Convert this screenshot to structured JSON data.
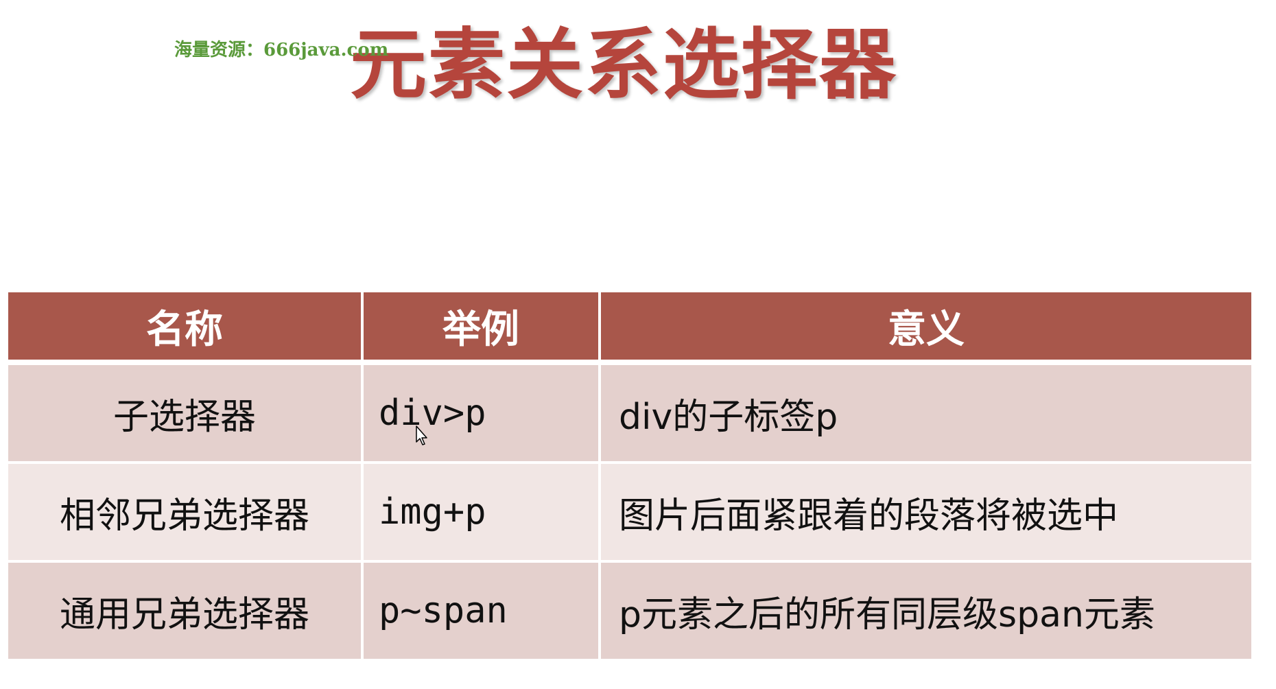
{
  "watermark": "海量资源：666java.com",
  "title": "元素关系选择器",
  "table": {
    "headers": [
      "名称",
      "举例",
      "意义"
    ],
    "rows": [
      {
        "name": "子选择器",
        "example": "div>p",
        "meaning": "div的子标签p"
      },
      {
        "name": "相邻兄弟选择器",
        "example": "img+p",
        "meaning": "图片后面紧跟着的段落将被选中"
      },
      {
        "name": "通用兄弟选择器",
        "example": "p~span",
        "meaning": "p元素之后的所有同层级span元素"
      }
    ]
  },
  "colors": {
    "title": "#b5453c",
    "header_bg": "#a8574b",
    "row_odd_bg": "#e4d0cd",
    "row_even_bg": "#f1e6e4",
    "watermark": "#5a9a3a"
  },
  "icons": {
    "cursor": "mouse-pointer-icon"
  }
}
